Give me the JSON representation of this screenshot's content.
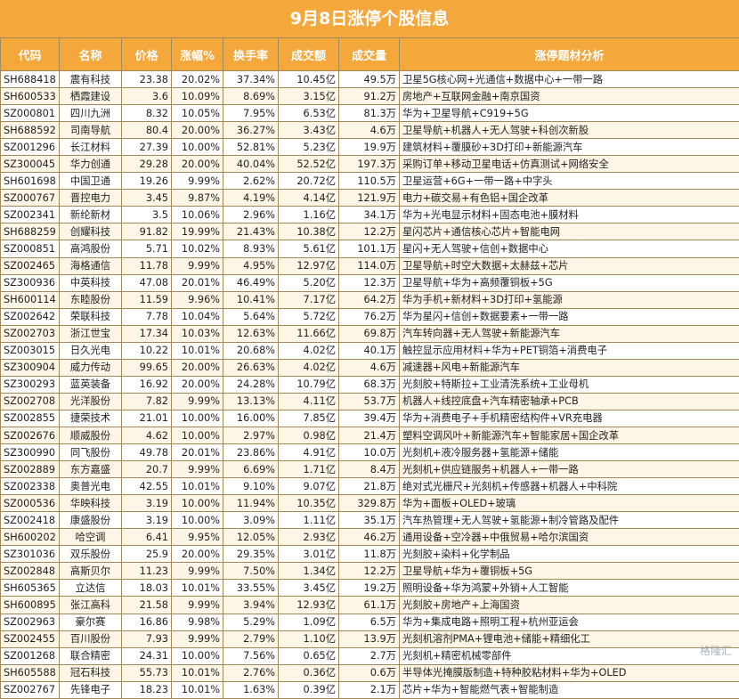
{
  "title": "9月8日涨停个股信息",
  "headers": [
    "代码",
    "名称",
    "价格",
    "涨幅%",
    "换手率",
    "成交额",
    "成交量",
    "涨停题材分析"
  ],
  "rows": [
    [
      "SH688418",
      "震有科技",
      "23.38",
      "20.02%",
      "37.34%",
      "10.45亿",
      "49.5万",
      "卫星5G核心网+光通信+数据中心+一带一路"
    ],
    [
      "SH600533",
      "栖霞建设",
      "3.6",
      "10.09%",
      "8.69%",
      "3.15亿",
      "91.2万",
      "房地产+互联网金融+南京国资"
    ],
    [
      "SZ000801",
      "四川九洲",
      "8.32",
      "10.05%",
      "7.95%",
      "6.53亿",
      "81.3万",
      "华为+卫星导航+C919+5G"
    ],
    [
      "SH688592",
      "司南导航",
      "80.4",
      "20.00%",
      "36.27%",
      "3.43亿",
      "4.6万",
      "卫星导航+机器人+无人驾驶+科创次新股"
    ],
    [
      "SZ001296",
      "长江材料",
      "27.39",
      "10.00%",
      "52.81%",
      "5.23亿",
      "19.9万",
      "建筑材料+覆膜砂+3D打印+新能源汽车"
    ],
    [
      "SZ300045",
      "华力创通",
      "29.28",
      "20.00%",
      "40.04%",
      "52.52亿",
      "197.3万",
      "采购订单+移动卫星电话+仿真测试+网络安全"
    ],
    [
      "SH601698",
      "中国卫通",
      "19.26",
      "9.99%",
      "2.62%",
      "20.72亿",
      "110.5万",
      "卫星运营+6G+一带一路+中字头"
    ],
    [
      "SZ000767",
      "晋控电力",
      "3.45",
      "9.87%",
      "4.19%",
      "4.14亿",
      "121.9万",
      "电力+碳交易+有色铝+国企改革"
    ],
    [
      "SZ002341",
      "新纶新材",
      "3.5",
      "10.06%",
      "2.96%",
      "1.16亿",
      "34.1万",
      "华为+光电显示材料+固态电池+膜材料"
    ],
    [
      "SH688259",
      "创耀科技",
      "91.82",
      "19.99%",
      "21.43%",
      "10.38亿",
      "12.2万",
      "星闪芯片+通信核心芯片+智能电网"
    ],
    [
      "SZ000851",
      "高鸿股份",
      "5.71",
      "10.02%",
      "8.93%",
      "5.61亿",
      "101.1万",
      "星闪+无人驾驶+信创+数据中心"
    ],
    [
      "SZ002465",
      "海格通信",
      "11.78",
      "9.99%",
      "4.95%",
      "12.97亿",
      "114.0万",
      "卫星导航+时空大数据+太赫兹+芯片"
    ],
    [
      "SZ300936",
      "中英科技",
      "47.08",
      "20.01%",
      "46.49%",
      "5.20亿",
      "12.3万",
      "卫星导航+华为+高频覆铜板+5G"
    ],
    [
      "SH600114",
      "东睦股份",
      "11.59",
      "9.96%",
      "10.41%",
      "7.17亿",
      "64.2万",
      "华为手机+新材料+3D打印+氢能源"
    ],
    [
      "SZ002642",
      "荣联科技",
      "7.78",
      "10.04%",
      "5.64%",
      "5.72亿",
      "76.2万",
      "华为星闪+信创+数据要素+一带一路"
    ],
    [
      "SZ002703",
      "浙江世宝",
      "17.34",
      "10.03%",
      "12.63%",
      "11.66亿",
      "69.8万",
      "汽车转向器+无人驾驶+新能源汽车"
    ],
    [
      "SZ003015",
      "日久光电",
      "10.22",
      "10.01%",
      "20.68%",
      "4.02亿",
      "40.1万",
      "触控显示应用材料+华为+PET铜箔+消费电子"
    ],
    [
      "SZ300904",
      "威力传动",
      "99.65",
      "20.00%",
      "26.63%",
      "4.02亿",
      "4.6万",
      "减速器+风电+新能源汽车"
    ],
    [
      "SZ300293",
      "蓝英装备",
      "16.92",
      "20.00%",
      "24.28%",
      "10.79亿",
      "68.3万",
      "光刻胶+特斯拉+工业清洗系统+工业母机"
    ],
    [
      "SZ002708",
      "光洋股份",
      "7.82",
      "9.99%",
      "13.13%",
      "4.11亿",
      "53.7万",
      "机器人+线控底盘+汽车精密轴承+PCB"
    ],
    [
      "SZ002855",
      "捷荣技术",
      "21.01",
      "10.00%",
      "16.00%",
      "7.85亿",
      "39.4万",
      "华为+消费电子+手机精密结构件+VR充电器"
    ],
    [
      "SZ002676",
      "顺威股份",
      "4.62",
      "10.00%",
      "2.97%",
      "0.98亿",
      "21.4万",
      "塑料空调风叶+新能源汽车+智能家居+国企改革"
    ],
    [
      "SZ300990",
      "同飞股份",
      "49.78",
      "20.01%",
      "23.86%",
      "4.91亿",
      "10.0万",
      "光刻机+液冷服务器+氢能源+储能"
    ],
    [
      "SZ002889",
      "东方嘉盛",
      "20.7",
      "9.99%",
      "6.69%",
      "1.71亿",
      "8.4万",
      "光刻机+供应链服务+机器人+一带一路"
    ],
    [
      "SZ002338",
      "奥普光电",
      "42.55",
      "10.01%",
      "9.10%",
      "9.07亿",
      "21.8万",
      "绝对式光栅尺+光刻机+传感器+机器人+中科院"
    ],
    [
      "SZ000536",
      "华映科技",
      "3.19",
      "10.00%",
      "11.94%",
      "10.35亿",
      "329.8万",
      "华为+面板+OLED+玻璃"
    ],
    [
      "SZ002418",
      "康盛股份",
      "3.19",
      "10.00%",
      "3.09%",
      "1.11亿",
      "35.1万",
      "汽车热管理+无人驾驶+氢能源+制冷管路及配件"
    ],
    [
      "SH600202",
      "哈空调",
      "6.41",
      "9.95%",
      "12.05%",
      "2.93亿",
      "46.2万",
      "通用设备+空冷器+中俄贸易+哈尔滨国资"
    ],
    [
      "SZ301036",
      "双乐股份",
      "25.9",
      "20.00%",
      "29.35%",
      "3.01亿",
      "11.8万",
      "光刻胶+染料+化学制品"
    ],
    [
      "SZ002848",
      "高斯贝尔",
      "11.23",
      "9.99%",
      "7.50%",
      "1.34亿",
      "12.2万",
      "卫星导航+华为+覆铜板+5G"
    ],
    [
      "SH605365",
      "立达信",
      "18.03",
      "10.01%",
      "33.55%",
      "3.45亿",
      "19.2万",
      "照明设备+华为鸿蒙+外销+人工智能"
    ],
    [
      "SH600895",
      "张江高科",
      "21.58",
      "9.99%",
      "3.94%",
      "12.93亿",
      "61.1万",
      "光刻胶+房地产+上海国资"
    ],
    [
      "SZ002963",
      "豪尔赛",
      "16.86",
      "9.98%",
      "5.29%",
      "1.09亿",
      "6.5万",
      "华为+集成电路+照明工程+杭州亚运会"
    ],
    [
      "SZ002455",
      "百川股份",
      "7.93",
      "9.99%",
      "2.79%",
      "1.10亿",
      "13.9万",
      "光刻机溶剂PMA+锂电池+储能+精细化工"
    ],
    [
      "SZ001268",
      "联合精密",
      "24.31",
      "10.00%",
      "7.56%",
      "0.65亿",
      "2.7万",
      "光刻机+精密机械零部件"
    ],
    [
      "SH605588",
      "冠石科技",
      "55.73",
      "10.01%",
      "2.76%",
      "0.36亿",
      "0.6万",
      "半导体光掩膜版制造+特种胶粘材料+华为+OLED"
    ],
    [
      "SZ002767",
      "先锋电子",
      "18.23",
      "10.01%",
      "1.63%",
      "0.39亿",
      "2.1万",
      "芯片+华为+智能燃气表+智能制造"
    ]
  ],
  "watermark": "格隆汇"
}
